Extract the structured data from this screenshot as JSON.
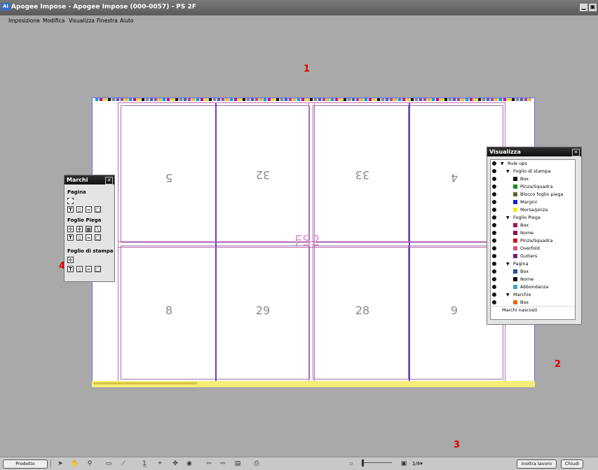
{
  "window": {
    "icon_text": "AI",
    "title": "Apogee Impose - Apogee Impose (000-0057) - PS 2F",
    "minimize": "▁",
    "maximize": "▣"
  },
  "menu": [
    {
      "label": "Imposizione"
    },
    {
      "label": "Modifica"
    },
    {
      "label": "Visualizza"
    },
    {
      "label": "Finestra"
    },
    {
      "label": "Aiuto"
    }
  ],
  "markers": [
    "1",
    "2",
    "3",
    "4"
  ],
  "sheet": {
    "label": "FS2",
    "top_pages": [
      "5",
      "32",
      "33",
      "4"
    ],
    "bottom_pages": [
      "8",
      "29",
      "28",
      "9"
    ]
  },
  "colors": {
    "accent_purple": "#6a3fbf",
    "rule_pink": "#c06ab0",
    "strip_yellow": "#f4ee78"
  },
  "marchi": {
    "title": "Marchi",
    "close": "✕",
    "sections": [
      "Pagina",
      "Foglio Piega",
      "Foglio di stampa"
    ]
  },
  "visualizza": {
    "title": "Visualizza",
    "close": "✕",
    "rows": [
      {
        "label": "Rule ups",
        "color": ""
      },
      {
        "label": "Foglio di stampa",
        "color": ""
      },
      {
        "label": "Box",
        "color": "#111111"
      },
      {
        "label": "Pinza/Squadra",
        "color": "#1a8a1a"
      },
      {
        "label": "Blocco foglio piega",
        "color": "#556b2f"
      },
      {
        "label": "Margini",
        "color": "#1c1cd6"
      },
      {
        "label": "Morsa/pinza",
        "color": "#f2ea1a"
      },
      {
        "label": "Foglio Piega",
        "color": ""
      },
      {
        "label": "Box",
        "color": "#a0145a"
      },
      {
        "label": "Nome",
        "color": "#8a1044"
      },
      {
        "label": "Pinza/Squadra",
        "color": "#d41a1a"
      },
      {
        "label": "Overfold",
        "color": "#e0508a"
      },
      {
        "label": "Gutters",
        "color": "#7a1a7a"
      },
      {
        "label": "Pagina",
        "color": ""
      },
      {
        "label": "Box",
        "color": "#2050a0"
      },
      {
        "label": "Nome",
        "color": "#111111"
      },
      {
        "label": "Abbondanza",
        "color": "#40a0d8"
      },
      {
        "label": "Marchio",
        "color": ""
      },
      {
        "label": "Box",
        "color": "#e86a10"
      },
      {
        "label": "Marchi nascosti",
        "color": ""
      }
    ]
  },
  "bottom": {
    "prodotto": "Prodotto",
    "zoom_value": "1/4▾",
    "inoltra": "Inoltra lavoro",
    "chiudi": "Chiudi"
  }
}
